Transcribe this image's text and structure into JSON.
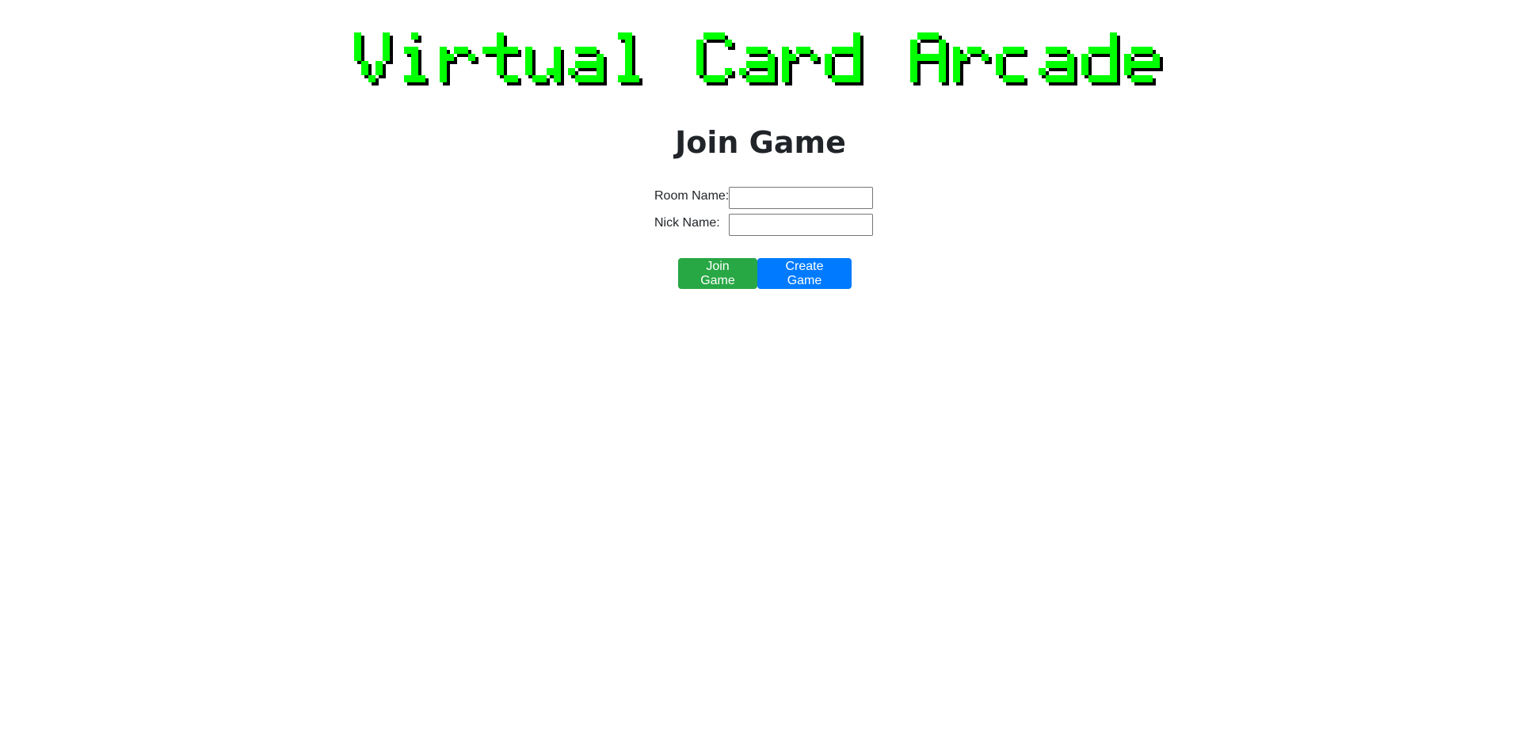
{
  "banner": {
    "logo_text": "Virtual Card Arcade",
    "fill_color": "#00ff00",
    "shadow_color": "#000000"
  },
  "main": {
    "title": "Join Game"
  },
  "form": {
    "room_name_label": "Room Name:",
    "room_name_value": "",
    "nick_name_label": "Nick Name:",
    "nick_name_value": ""
  },
  "actions": {
    "join_label": "Join Game",
    "join_color": "#28a745",
    "create_label": "Create Game",
    "create_color": "#007bff"
  }
}
